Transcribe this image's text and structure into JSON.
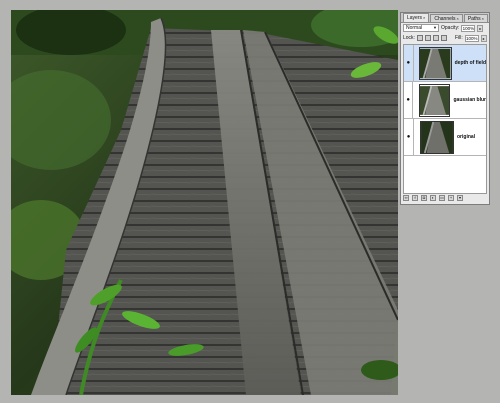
{
  "palette": {
    "tabs": [
      {
        "label": "Layers"
      },
      {
        "label": "Channels"
      },
      {
        "label": "Paths"
      }
    ],
    "blend_mode": "Normal",
    "opacity_label": "Opacity:",
    "opacity_value": "100%",
    "lock_label": "Lock:",
    "fill_label": "Fill:",
    "fill_value": "100%",
    "layers": [
      {
        "name": "depth of field",
        "selected": true
      },
      {
        "name": "gaussian blur",
        "selected": false
      },
      {
        "name": "original",
        "selected": false
      }
    ]
  },
  "colors": {
    "canvas_bg": "#b4b4b2",
    "palette_bg": "#e9e9e9",
    "selected_layer": "#cde0f7"
  }
}
